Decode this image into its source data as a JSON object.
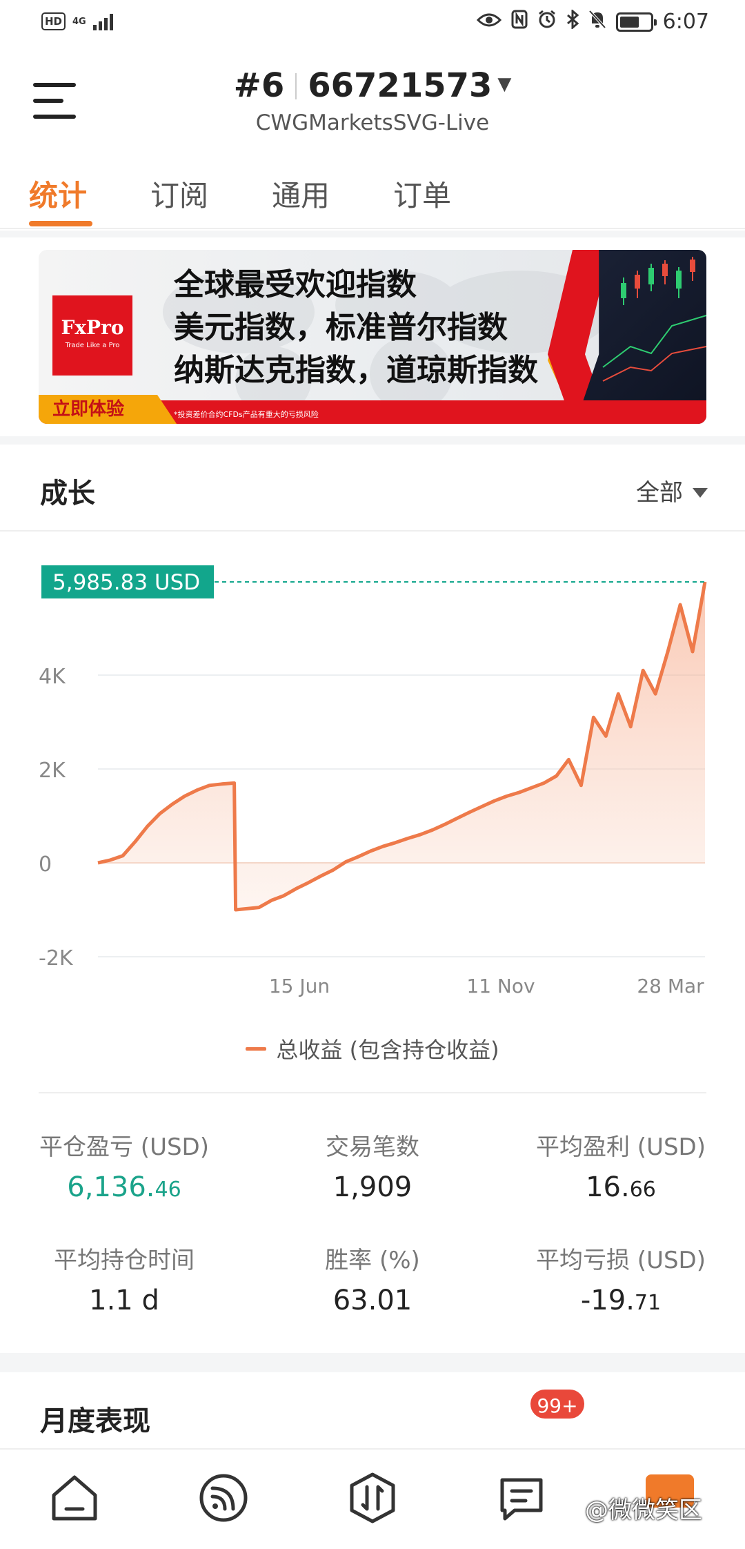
{
  "status_bar": {
    "hd": "HD",
    "network": "4G",
    "time": "6:07",
    "battery_pct": 65
  },
  "header": {
    "account_prefix": "#6",
    "account_number": "66721573",
    "server": "CWGMarketsSVG-Live"
  },
  "tabs": [
    {
      "label": "统计",
      "active": true
    },
    {
      "label": "订阅",
      "active": false
    },
    {
      "label": "通用",
      "active": false
    },
    {
      "label": "订单",
      "active": false
    }
  ],
  "banner": {
    "logo_text": "FxPro",
    "logo_tagline": "Trade Like a Pro",
    "lines": [
      "全球最受欢迎指数",
      "美元指数，标准普尔指数",
      "纳斯达克指数，道琼斯指数"
    ],
    "cta": "立即体验",
    "disclaimer": "*投资差价合约CFDs产品有重大的亏损风险"
  },
  "growth": {
    "title": "成长",
    "period": "全部"
  },
  "chart_data": {
    "type": "area",
    "current_value_label": "5,985.83 USD",
    "current_value": 5985.83,
    "y_ticks": [
      "4K",
      "2K",
      "0",
      "-2K"
    ],
    "y_tick_values": [
      4000,
      2000,
      0,
      -2000
    ],
    "x_ticks": [
      "15 Jun",
      "11 Nov",
      "28 Mar"
    ],
    "ylim": [
      -2000,
      6000
    ],
    "series": [
      {
        "name": "总收益 (包含持仓收益)",
        "color": "#ee7a4a",
        "values": [
          0,
          60,
          150,
          450,
          780,
          1050,
          1250,
          1420,
          1550,
          1650,
          1680,
          1700,
          -1000,
          -950,
          -800,
          -700,
          -550,
          -420,
          -280,
          -150,
          20,
          130,
          250,
          350,
          430,
          520,
          600,
          700,
          820,
          950,
          1080,
          1200,
          1320,
          1420,
          1500,
          1600,
          1700,
          1850,
          2200,
          1650,
          3100,
          2700,
          3600,
          2900,
          4100,
          3600,
          4500,
          5500,
          4500,
          5985.83
        ]
      }
    ]
  },
  "legend_label": "总收益 (包含持仓收益)",
  "stats": [
    {
      "label": "平仓盈亏 (USD)",
      "value_main": "6,136.",
      "value_dec": "46",
      "green": true
    },
    {
      "label": "交易笔数",
      "value_main": "1,909",
      "value_dec": "",
      "green": false
    },
    {
      "label": "平均盈利 (USD)",
      "value_main": "16.",
      "value_dec": "66",
      "green": false
    },
    {
      "label": "平均持仓时间",
      "value_main": "1.1 d",
      "value_dec": "",
      "green": false
    },
    {
      "label": "胜率 (%)",
      "value_main": "63.01",
      "value_dec": "",
      "green": false
    },
    {
      "label": "平均亏损 (USD)",
      "value_main": "-19.",
      "value_dec": "71",
      "green": false
    }
  ],
  "monthly_title": "月度表现",
  "bottom_nav": {
    "items": [
      "home-icon",
      "feed-icon",
      "trade-icon",
      "message-icon",
      "profile-icon"
    ],
    "badge": "99+"
  },
  "watermark": "@微微笑区",
  "colors": {
    "accent": "#f07a2a",
    "green": "#1aa38a",
    "line": "#ee7a4a",
    "teal_tag": "#12a68c"
  }
}
